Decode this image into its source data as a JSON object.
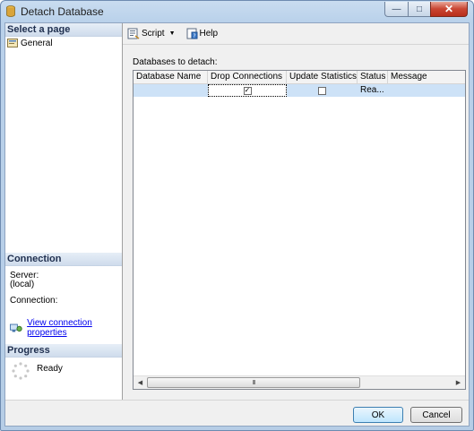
{
  "window": {
    "title": "Detach Database"
  },
  "left_pane": {
    "select_page_header": "Select a page",
    "pages": [
      {
        "label": "General"
      }
    ],
    "connection_header": "Connection",
    "server_label": "Server:",
    "server_value": "(local)",
    "connection_label": "Connection:",
    "connection_value": "",
    "view_connection_link": "View connection properties",
    "progress_header": "Progress",
    "progress_status": "Ready"
  },
  "toolbar": {
    "script_label": "Script",
    "help_label": "Help"
  },
  "main": {
    "databases_label": "Databases to detach:",
    "columns": [
      "Database Name",
      "Drop Connections",
      "Update Statistics",
      "Status",
      "Message"
    ],
    "rows": [
      {
        "database_name": "",
        "drop_connections": true,
        "update_statistics": false,
        "status": "Rea...",
        "message": ""
      }
    ],
    "scroll_grip": "III"
  },
  "buttons": {
    "ok": "OK",
    "cancel": "Cancel"
  },
  "icons": {
    "app": "database-icon",
    "script": "script-icon",
    "help": "help-icon",
    "page": "general-page-icon",
    "connection": "connection-properties-icon",
    "progress": "spinner-icon"
  },
  "colors": {
    "selection": "#cde2f7",
    "link": "#0000ee",
    "section_header": "#cfdcec"
  }
}
